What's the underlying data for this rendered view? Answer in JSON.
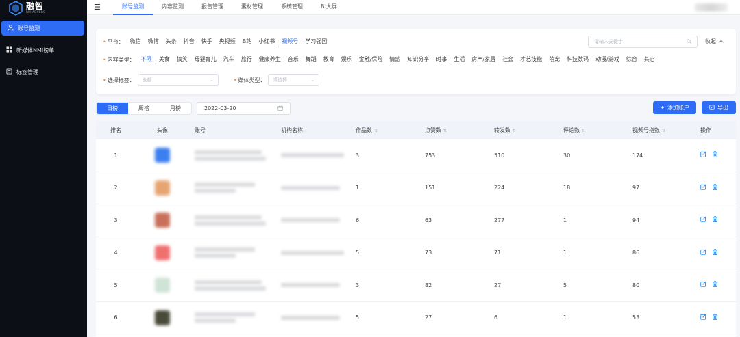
{
  "logo": {
    "title": "融智",
    "subtitle": "RM ADVERS"
  },
  "sidebar": {
    "items": [
      {
        "label": "账号监测",
        "icon": "user-icon",
        "active": true
      },
      {
        "label": "新媒体NMI榜单",
        "icon": "grid-icon",
        "active": false
      },
      {
        "label": "标签管理",
        "icon": "tag-icon",
        "active": false
      }
    ]
  },
  "topnav": {
    "items": [
      {
        "label": "账号监测",
        "active": true
      },
      {
        "label": "内容监测",
        "active": false
      },
      {
        "label": "报告管理",
        "active": false
      },
      {
        "label": "素材管理",
        "active": false
      },
      {
        "label": "系统管理",
        "active": false
      },
      {
        "label": "BI大屏",
        "active": false
      }
    ]
  },
  "filters": {
    "platform_label": "平台：",
    "platforms": [
      "微信",
      "微博",
      "头条",
      "抖音",
      "快手",
      "央视频",
      "B站",
      "小红书",
      "视频号",
      "学习强国"
    ],
    "platform_active": 8,
    "content_type_label": "内容类型：",
    "content_types": [
      "不限",
      "美食",
      "搞笑",
      "母婴育儿",
      "汽车",
      "旅行",
      "健康养生",
      "音乐",
      "舞蹈",
      "教育",
      "娱乐",
      "金融/保险",
      "情感",
      "知识分享",
      "时事",
      "生活",
      "房产/家居",
      "社会",
      "才艺技能",
      "萌宠",
      "科技数码",
      "动漫/游戏",
      "综合",
      "其它"
    ],
    "content_type_active": 0,
    "tag_label": "选择标签：",
    "tag_value": "全部",
    "media_label": "媒体类型：",
    "media_placeholder": "请选择",
    "search_placeholder": "请输入关键字",
    "collapse_label": "收起"
  },
  "toolbar": {
    "periods": [
      "日榜",
      "周榜",
      "月榜"
    ],
    "period_active": 0,
    "date": "2022-03-20",
    "add_label": "添加账户",
    "export_label": "导出"
  },
  "table": {
    "headers": {
      "rank": "排名",
      "avatar": "头像",
      "account": "账号",
      "org": "机构名称",
      "works": "作品数",
      "likes": "点赞数",
      "shares": "转发数",
      "comments": "评论数",
      "index": "视频号指数",
      "ops": "操作"
    },
    "rows": [
      {
        "rank": "1",
        "works": "3",
        "likes": "753",
        "shares": "510",
        "comments": "30",
        "index": "174",
        "avatar_color": "#3b7ff0"
      },
      {
        "rank": "2",
        "works": "1",
        "likes": "151",
        "shares": "224",
        "comments": "18",
        "index": "97",
        "avatar_color": "#e6a472"
      },
      {
        "rank": "3",
        "works": "6",
        "likes": "63",
        "shares": "277",
        "comments": "1",
        "index": "94",
        "avatar_color": "#c9705a"
      },
      {
        "rank": "4",
        "works": "5",
        "likes": "73",
        "shares": "71",
        "comments": "1",
        "index": "86",
        "avatar_color": "#f07070"
      },
      {
        "rank": "5",
        "works": "3",
        "likes": "82",
        "shares": "27",
        "comments": "5",
        "index": "80",
        "avatar_color": "#cfe3d6"
      },
      {
        "rank": "6",
        "works": "5",
        "likes": "27",
        "shares": "6",
        "comments": "1",
        "index": "53",
        "avatar_color": "#4a4a3a"
      }
    ]
  },
  "colors": {
    "accent": "#2e6cf6",
    "sidebar_bg": "#0d0f16"
  }
}
